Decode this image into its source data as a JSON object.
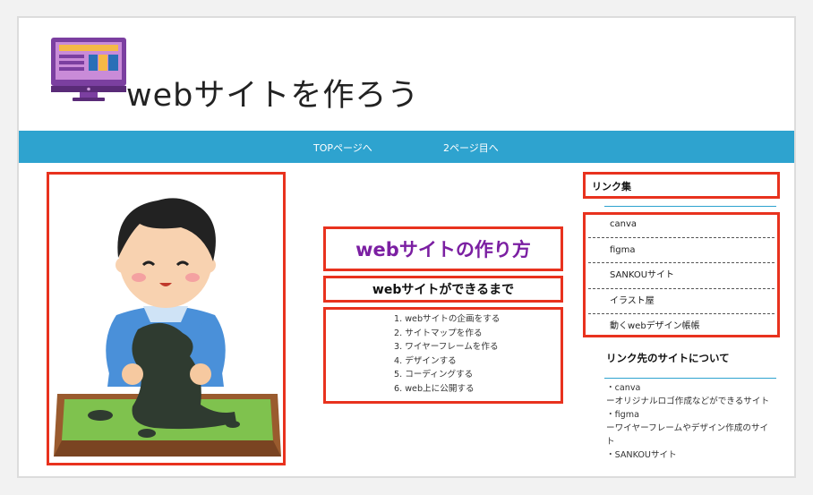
{
  "header": {
    "site_title": "webサイトを作ろう"
  },
  "nav": {
    "items": [
      "TOPページへ",
      "2ページ目へ"
    ]
  },
  "main": {
    "title": "webサイトの作り方",
    "subtitle": "webサイトができるまで",
    "steps": [
      "1. webサイトの企画をする",
      "2. サイトマップを作る",
      "3. ワイヤーフレームを作る",
      "4. デザインする",
      "5. コーディングする",
      "6. web上に公開する"
    ]
  },
  "sidebar": {
    "links_heading": "リンク集",
    "links": [
      "canva",
      "figma",
      "SANKOUサイト",
      "イラスト屋",
      "動くwebデザイン帳帳"
    ],
    "about_heading": "リンク先のサイトについて",
    "about_lines": [
      "・canva",
      "ーオリジナルロゴ作成などができるサイト",
      "・figma",
      "ーワイヤーフレームやデザイン作成のサイト",
      "・SANKOUサイト"
    ]
  },
  "colors": {
    "nav_bg": "#2ea3cf",
    "highlight_border": "#e8321e",
    "title_purple": "#7b1fa2"
  }
}
